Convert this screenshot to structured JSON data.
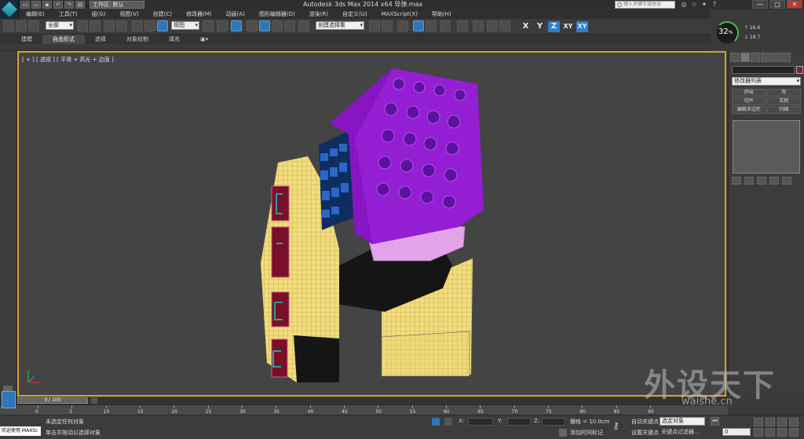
{
  "titlebar": {
    "workspace": "工作区: 默认",
    "title": "Autodesk 3ds Max  2014 x64    导弹.max",
    "search_placeholder": "键入关键字或短语",
    "help_icon": "help-icon",
    "window_buttons": [
      "—",
      "□",
      "✕"
    ]
  },
  "menu": [
    "编辑(E)",
    "工具(T)",
    "组(G)",
    "视图(V)",
    "创建(C)",
    "修改器(M)",
    "动画(A)",
    "图形编辑器(D)",
    "渲染(R)",
    "自定义(U)",
    "MAXScript(X)",
    "帮助(H)"
  ],
  "toolbar": {
    "filter_select": "全部",
    "view_select": "视图",
    "named_selection": "创建选择集",
    "axis_x": "X",
    "axis_y": "Y",
    "axis_z": "Z",
    "axis_xy": "XY",
    "axis_xy2": "XY"
  },
  "ribbon": [
    "建模",
    "自由形式",
    "选择",
    "对象绘制",
    "填充",
    "▣▾"
  ],
  "hud": {
    "percent": "32",
    "percent_unit": "%",
    "upload": "↑ 16.6",
    "download": "↓ 18.7"
  },
  "viewport": {
    "label": "[ + ] [ 透视 ] [ 平滑 + 高光 + 边面 ]",
    "colors": {
      "frame": "#d9a324",
      "yellow": "#f2dc7c",
      "purple": "#8b16c8",
      "pink": "#e3a3e8",
      "blue": "#2a67c8",
      "black": "#151515",
      "red": "#7a0f2a",
      "teal": "#1aa8a0"
    }
  },
  "command_panel": {
    "modifier_list": "修改器列表",
    "buttons": [
      "挤出",
      "壳",
      "切片",
      "车削",
      "编辑多边形",
      "扫描"
    ]
  },
  "timeline": {
    "slider": "0 / 100",
    "ticks": [
      "0",
      "5",
      "10",
      "15",
      "20",
      "25",
      "30",
      "35",
      "40",
      "45",
      "50",
      "55",
      "60",
      "65",
      "70",
      "75",
      "80",
      "85",
      "90"
    ]
  },
  "status": {
    "welcome": "欢迎使用 MAXSc",
    "selection": "未选定任何对象",
    "prompt": "单击并拖动以选择对象",
    "x_label": "X:",
    "y_label": "Y:",
    "z_label": "Z:",
    "grid": "栅格 = 10.0cm",
    "time_tag": "添加时间标记",
    "auto_key": "自动关键点",
    "set_key": "设置关键点",
    "selected_objects": "选定对象",
    "key_filters": "关键点过滤器...",
    "frame": "0"
  },
  "watermark": {
    "text": "外设天下",
    "url": "waishe.cn"
  }
}
